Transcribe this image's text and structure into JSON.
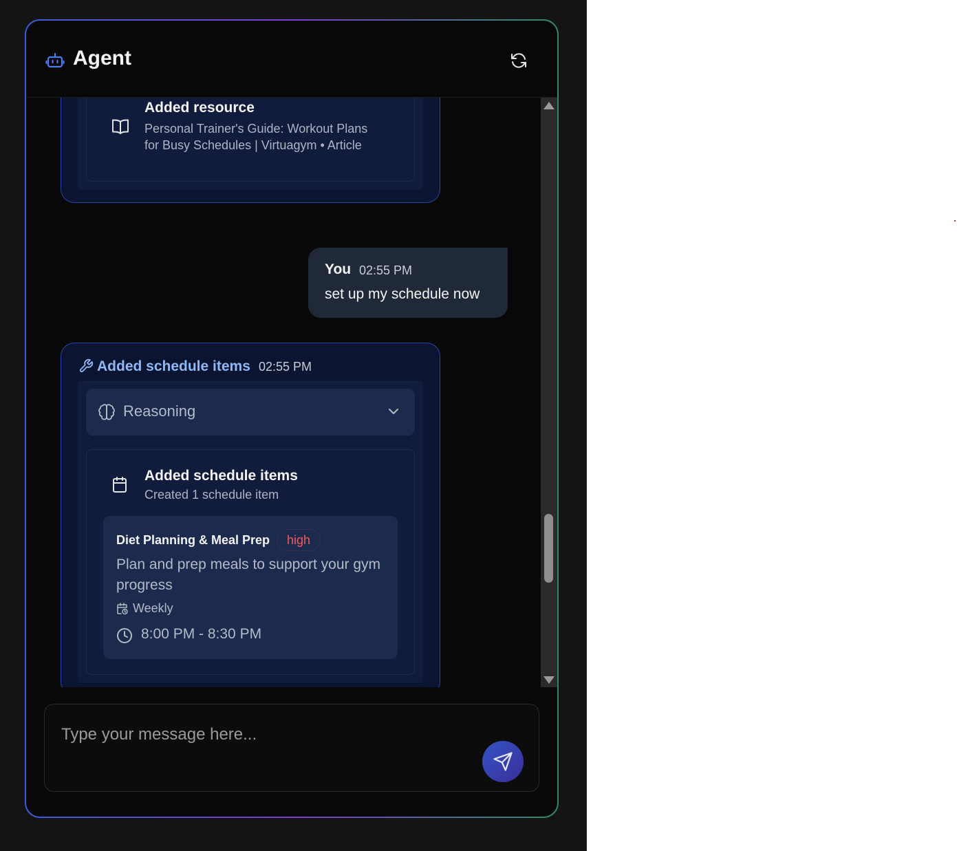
{
  "header": {
    "title": "Agent",
    "bot_icon": "bot-icon",
    "refresh_icon": "refresh-icon",
    "accent_color": "#4d7cf2"
  },
  "messages": {
    "resource_card": {
      "title": "Added resource",
      "line1": "Personal Trainer's Guide: Workout Plans",
      "line2": "for Busy Schedules | Virtuagym • Article",
      "icon": "book-open-icon"
    },
    "user": {
      "who": "You",
      "time": "02:55 PM",
      "text": "set up my schedule now"
    },
    "schedule_card": {
      "title": "Added schedule items",
      "time": "02:55 PM",
      "icon": "wrench-icon",
      "reasoning_label": "Reasoning",
      "tool_title": "Added schedule items",
      "tool_sub": "Created 1 schedule item",
      "item": {
        "name": "Diet Planning & Meal Prep",
        "priority": "high",
        "priority_color": "#f25c5c",
        "description": "Plan and prep meals to support your gym progress",
        "frequency": "Weekly",
        "time_range": "8:00 PM - 8:30 PM"
      }
    }
  },
  "composer": {
    "placeholder": "Type your message here..."
  }
}
